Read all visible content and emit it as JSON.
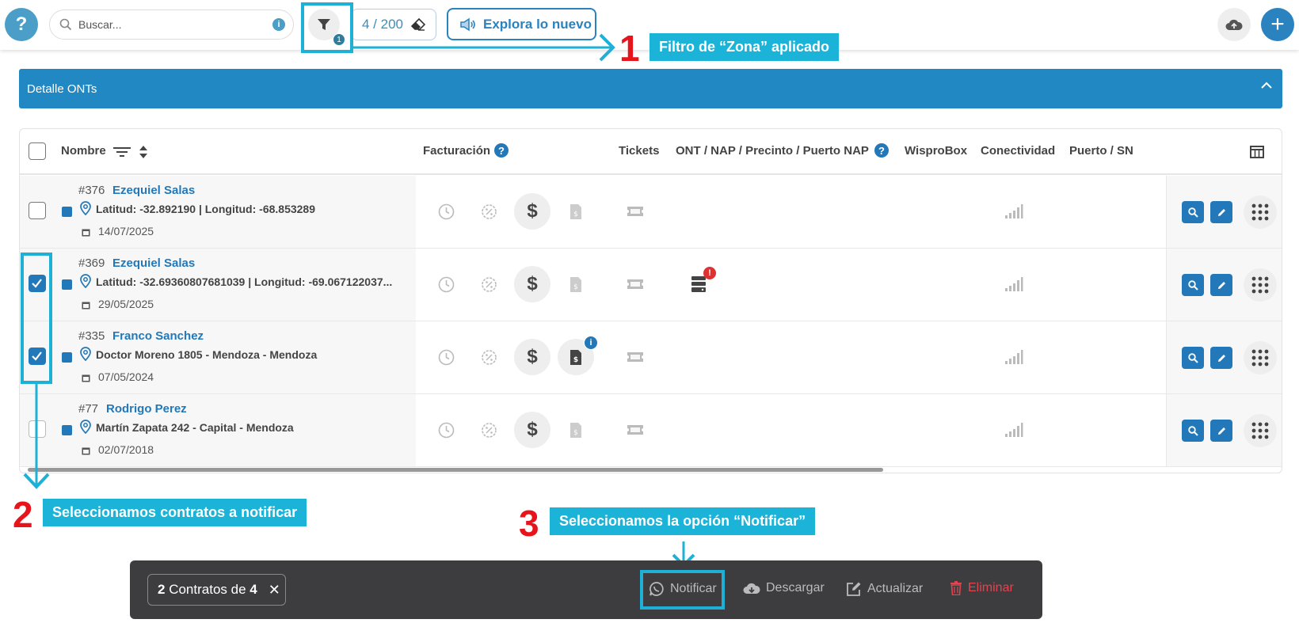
{
  "topbar": {
    "help_label": "?",
    "search_placeholder": "Buscar...",
    "filter_badge": "1",
    "counter": "4 / 200",
    "explore_label": "Explora lo nuevo",
    "plus_label": "+"
  },
  "panel": {
    "title": "Detalle ONTs"
  },
  "table": {
    "headers": {
      "nombre": "Nombre",
      "facturacion": "Facturación",
      "tickets": "Tickets",
      "ont": "ONT / NAP / Precinto / Puerto NAP",
      "wisprobox": "WisproBox",
      "conectividad": "Conectividad",
      "puerto": "Puerto / SN"
    },
    "rows": [
      {
        "id": "#376",
        "name": "Ezequiel Salas",
        "address": "Latitud: -32.892190 | Longitud: -68.853289",
        "date": "14/07/2025",
        "checked": false
      },
      {
        "id": "#369",
        "name": "Ezequiel Salas",
        "address": "Latitud: -32.69360807681039 | Longitud: -69.067122037...",
        "date": "29/05/2025",
        "checked": true
      },
      {
        "id": "#335",
        "name": "Franco Sanchez",
        "address": "Doctor Moreno 1805 - Mendoza - Mendoza",
        "date": "07/05/2024",
        "checked": true
      },
      {
        "id": "#77",
        "name": "Rodrigo Perez",
        "address": "Martín Zapata 242 - Capital - Mendoza",
        "date": "02/07/2018",
        "checked": false
      }
    ],
    "dollar": "$",
    "badge_red": "!",
    "badge_info": "i"
  },
  "annotations": {
    "one": {
      "number": "1",
      "text": "Filtro de “Zona” aplicado"
    },
    "two": {
      "number": "2",
      "text": "Seleccionamos contratos a notificar"
    },
    "three": {
      "number": "3",
      "text": "Seleccionamos la opción “Notificar”"
    }
  },
  "bulkbar": {
    "selected": "2",
    "middle": " Contratos de ",
    "total": "4",
    "close": "✕",
    "notificar": "Notificar",
    "descargar": "Descargar",
    "actualizar": "Actualizar",
    "eliminar": "Eliminar"
  },
  "colors": {
    "accent": "#2288c4",
    "annotation": "#1cb3d8",
    "annotation_number": "#e8141c",
    "danger": "#e2444f"
  }
}
